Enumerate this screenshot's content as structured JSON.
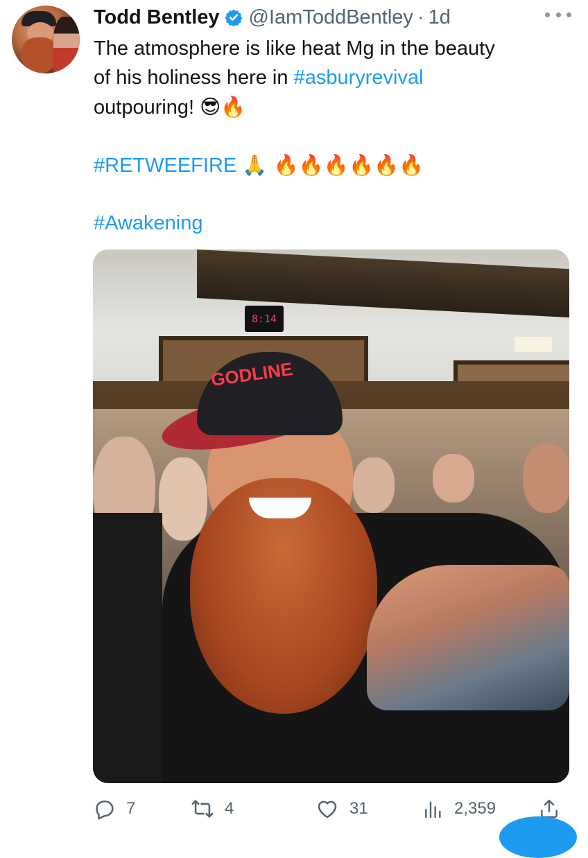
{
  "tweet": {
    "author_name": "Todd Bentley",
    "handle": "@IamToddBentley",
    "separator": "·",
    "time": "1d",
    "lines": [
      "The atmosphere is like heat Mg in the beauty",
      "of his holiness here in ",
      "#asburyrevival",
      "outpouring! ",
      "😎🔥",
      "#RETWEEFIRE",
      "🙏 🔥🔥🔥🔥🔥🔥",
      "#Awakening"
    ]
  },
  "media": {
    "clock_text": "8:14",
    "hat_text": "GODLINE"
  },
  "actions": {
    "replies": "7",
    "retweets": "4",
    "likes": "31",
    "views": "2,359"
  },
  "icons": {
    "verified": "verified-badge-icon",
    "more": "more-options-icon",
    "reply": "reply-icon",
    "retweet": "retweet-icon",
    "like": "like-icon",
    "views": "views-icon",
    "share": "share-icon"
  },
  "colors": {
    "link": "#1d9bf0",
    "text": "#0f1419",
    "secondary": "#536471"
  }
}
